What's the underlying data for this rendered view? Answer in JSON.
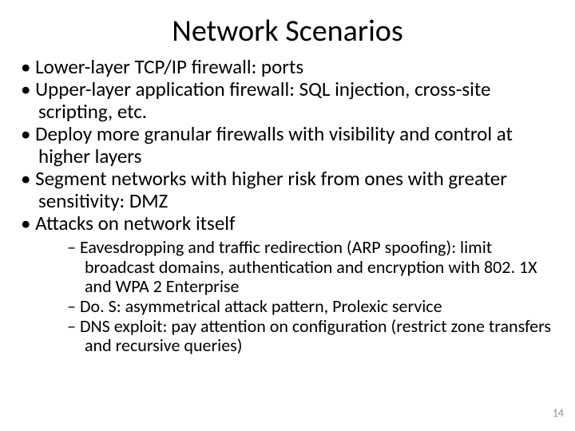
{
  "title": "Network Scenarios",
  "bullets": [
    "Lower-layer TCP/IP firewall: ports",
    "Upper-layer application firewall: SQL injection, cross-site scripting, etc.",
    "Deploy more granular firewalls with visibility and control at higher layers",
    "Segment networks with higher risk from ones with greater sensitivity: DMZ",
    "Attacks on network itself"
  ],
  "sub_bullets": [
    "Eavesdropping and traffic redirection (ARP spoofing): limit broadcast domains, authentication and encryption with 802. 1X and WPA 2 Enterprise",
    "Do. S: asymmetrical attack pattern, Prolexic service",
    "DNS exploit: pay attention on configuration (restrict zone transfers and recursive queries)"
  ],
  "page_number": "14"
}
